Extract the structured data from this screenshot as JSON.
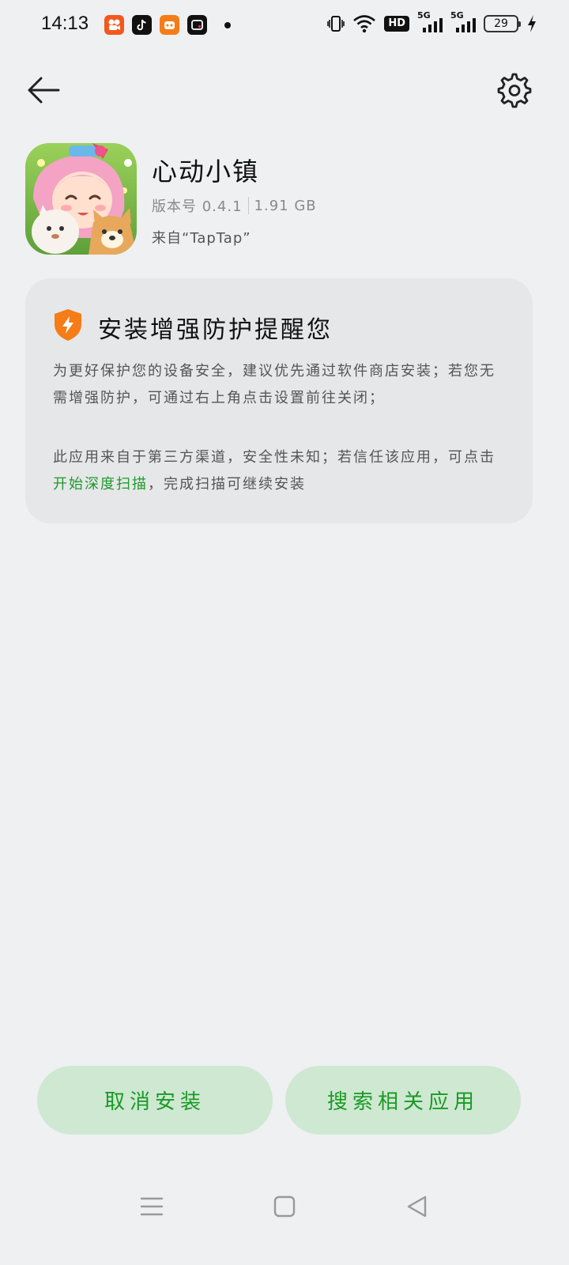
{
  "status_bar": {
    "time": "14:13",
    "battery": "29",
    "hd_label": "HD",
    "sim1_label": "5G",
    "sim2_label": "5G"
  },
  "app": {
    "name": "心动小镇",
    "version_label": "版本号 0.4.1",
    "size": "1.91 GB",
    "source": "来自“TapTap”"
  },
  "warning": {
    "title": "安装增强防护提醒您",
    "paragraph1": "为更好保护您的设备安全，建议优先通过软件商店安装；若您无需增强防护，可通过右上角点击设置前往关闭；",
    "paragraph2_before": "此应用来自于第三方渠道，安全性未知；若信任该应用，可点击",
    "paragraph2_link": "开始深度扫描",
    "paragraph2_after": "，完成扫描可继续安装",
    "accent_color": "#1d9a2a",
    "shield_color": "#f57c16"
  },
  "buttons": {
    "cancel": "取消安装",
    "search": "搜索相关应用"
  },
  "icons": {
    "back": "arrow-left-icon",
    "settings": "gear-icon",
    "nav_menu": "menu-icon",
    "nav_home": "square-icon",
    "nav_back": "triangle-back-icon"
  }
}
